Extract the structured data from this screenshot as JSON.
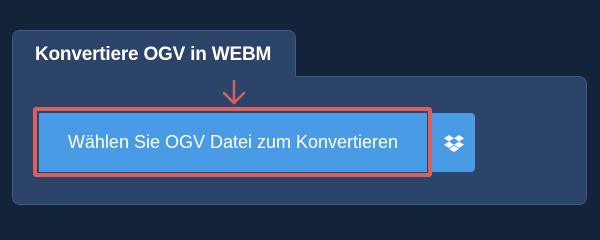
{
  "converter": {
    "title": "Konvertiere OGV in WEBM",
    "choose_file_label": "Wählen Sie OGV Datei zum Konvertieren",
    "dropbox_icon": "dropbox-icon"
  },
  "colors": {
    "page_background": "#13233a",
    "panel_background": "#2b4468",
    "button_blue": "#4a9be6",
    "highlight_red": "#d9605e"
  }
}
